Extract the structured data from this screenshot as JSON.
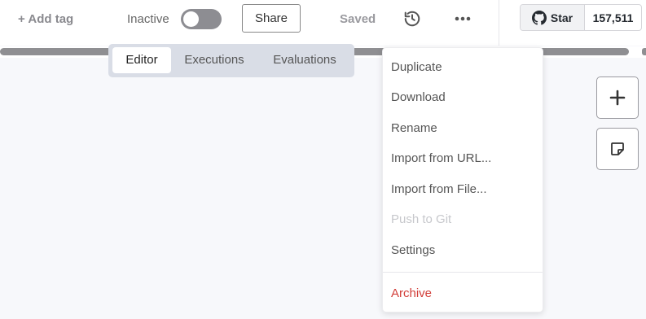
{
  "header": {
    "add_tag": "+ Add tag",
    "status_label": "Inactive",
    "share_label": "Share",
    "saved_label": "Saved"
  },
  "github": {
    "star_label": "Star",
    "star_count": "157,511"
  },
  "tabs": [
    {
      "label": "Editor",
      "active": true
    },
    {
      "label": "Executions",
      "active": false
    },
    {
      "label": "Evaluations",
      "active": false
    }
  ],
  "menu": {
    "items": [
      {
        "label": "Duplicate"
      },
      {
        "label": "Download"
      },
      {
        "label": "Rename"
      },
      {
        "label": "Import from URL..."
      },
      {
        "label": "Import from File..."
      },
      {
        "label": "Push to Git",
        "disabled": true
      },
      {
        "label": "Settings"
      },
      {
        "label": "Archive",
        "danger": true
      }
    ]
  },
  "icons": {
    "history": "history-icon",
    "more": "more-horizontal-icon",
    "github": "github-icon",
    "add": "plus-icon",
    "sticky_note": "sticky-note-icon"
  },
  "colors": {
    "danger": "#d23f3a",
    "toggle_off": "#8d8d92",
    "tab_bar": "#d9dde6",
    "canvas": "#f7f8fb"
  }
}
